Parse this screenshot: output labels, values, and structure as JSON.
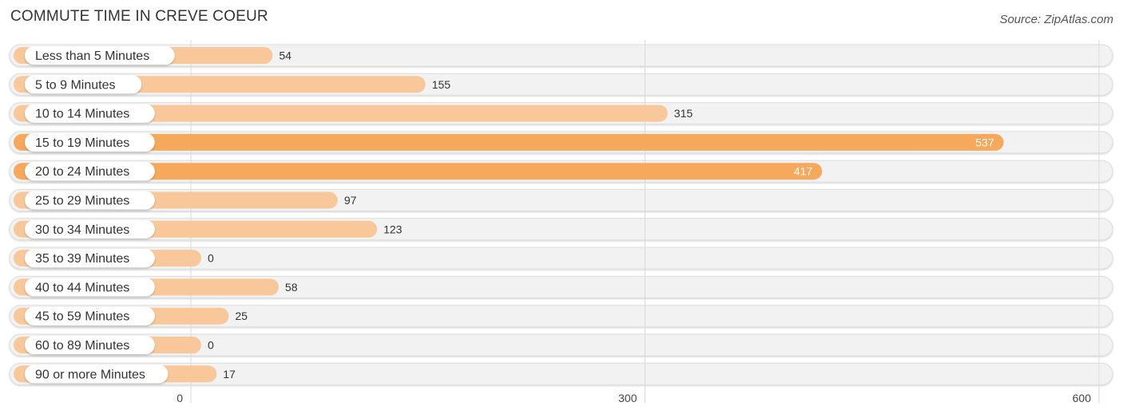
{
  "header": {
    "title": "COMMUTE TIME IN CREVE COEUR",
    "source": "Source: ZipAtlas.com"
  },
  "chart_data": {
    "type": "bar",
    "orientation": "horizontal",
    "title": "COMMUTE TIME IN CREVE COEUR",
    "xlabel": "",
    "ylabel": "",
    "categories": [
      "Less than 5 Minutes",
      "5 to 9 Minutes",
      "10 to 14 Minutes",
      "15 to 19 Minutes",
      "20 to 24 Minutes",
      "25 to 29 Minutes",
      "30 to 34 Minutes",
      "35 to 39 Minutes",
      "40 to 44 Minutes",
      "45 to 59 Minutes",
      "60 to 89 Minutes",
      "90 or more Minutes"
    ],
    "values": [
      54,
      155,
      315,
      537,
      417,
      97,
      123,
      0,
      58,
      25,
      0,
      17
    ],
    "xlim": [
      0,
      600
    ],
    "xticks": [
      0,
      300,
      600
    ],
    "xtick_labels": [
      "0",
      "300",
      "600"
    ],
    "grid": true,
    "legend": "none",
    "colors": {
      "bar_light": "#f9c89a",
      "bar_strong": "#f6a85c",
      "track": "#f2f2f2",
      "track_border": "#dddddd",
      "label_pill": "#ffffff",
      "value_outside": "#333333",
      "value_inside": "#ffffff",
      "gridline": "#d9d9d9"
    }
  }
}
